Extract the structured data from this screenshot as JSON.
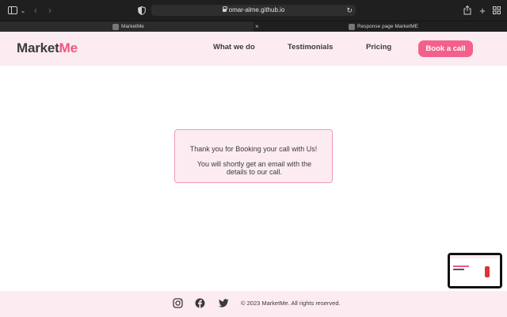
{
  "browser": {
    "url": "omar-alme.github.io",
    "tabs": [
      {
        "title": "MarketMe"
      },
      {
        "title": "Response page MarketME"
      }
    ]
  },
  "site": {
    "logo_main": "Market",
    "logo_accent": "Me",
    "nav": [
      "What we do",
      "Testimonials",
      "Pricing"
    ],
    "cta_label": "Book a call"
  },
  "message": {
    "line1": "Thank you for Booking your call with Us!",
    "line2": "You will shortly get an email with the details to our call."
  },
  "footer": {
    "copyright": "© 2023 MarketMe. All rights reserved."
  },
  "colors": {
    "brand": "#f0567f",
    "header_bg": "#fcecf1",
    "cta_bg": "#f4608c"
  }
}
